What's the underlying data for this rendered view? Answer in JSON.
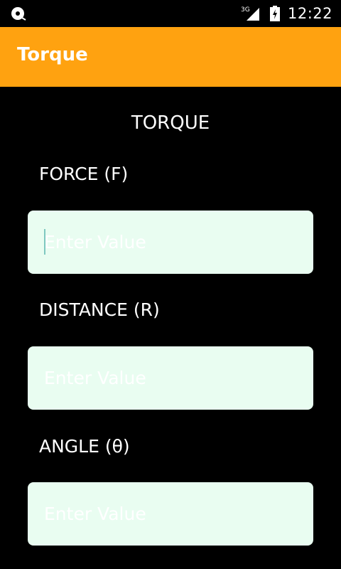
{
  "status_bar": {
    "network": "3G",
    "time": "12:22",
    "icons": [
      "sync-disc-icon",
      "signal-icon",
      "battery-charging-icon"
    ]
  },
  "app_bar": {
    "title": "Torque",
    "color": "#ffa210"
  },
  "main": {
    "heading": "TORQUE",
    "fields": [
      {
        "label": "FORCE (F)",
        "placeholder": "Enter Value",
        "value": ""
      },
      {
        "label": "DISTANCE (R)",
        "placeholder": "Enter Value",
        "value": ""
      },
      {
        "label": "ANGLE (θ)",
        "placeholder": "Enter Value",
        "value": ""
      }
    ]
  },
  "colors": {
    "background": "#000000",
    "input_background": "#e9fdf1",
    "accent": "#ffa210"
  }
}
